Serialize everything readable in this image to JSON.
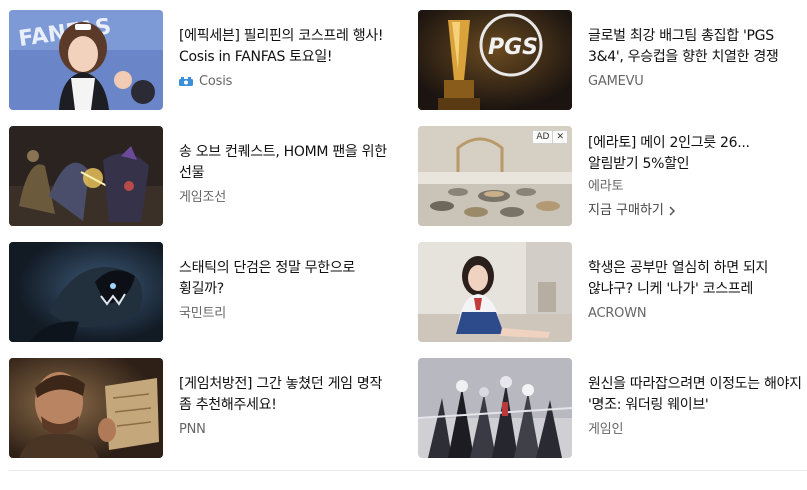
{
  "articles": [
    {
      "title": "[에픽세븐] 필리핀의 코스프레 행사! Cosis in FANFAS 토요일!",
      "source": "Cosis",
      "source_icon": "cosis-logo-icon"
    },
    {
      "title": "글로벌 최강 배그팀 총집합 'PGS 3&4', 우승컵을 향한 치열한 경쟁",
      "source": "GAMEVU"
    },
    {
      "title": "송 오브 컨퀘스트, HOMM 팬을 위한 선물",
      "source": "게임조선"
    },
    {
      "title": "[에라토] 메이 2인그릇 26... 알림받기 5%할인",
      "source": "에라토",
      "ad_label": "AD",
      "ad_close": "✕",
      "cta": "지금 구매하기"
    },
    {
      "title": "스태틱의 단검은 정말 무한으로 휭길까?",
      "source": "국민트리"
    },
    {
      "title": "학생은 공부만 열심히 하면 되지 않냐구? 니케 '나가' 코스프레",
      "source": "ACROWN"
    },
    {
      "title": "[게임처방전] 그간 놓쳤던 게임 명작 좀 추천해주세요!",
      "source": "PNN"
    },
    {
      "title": "원신을 따라잡으려면 이정도는 해야지 '명조: 워더링 웨이브'",
      "source": "게임인"
    }
  ]
}
